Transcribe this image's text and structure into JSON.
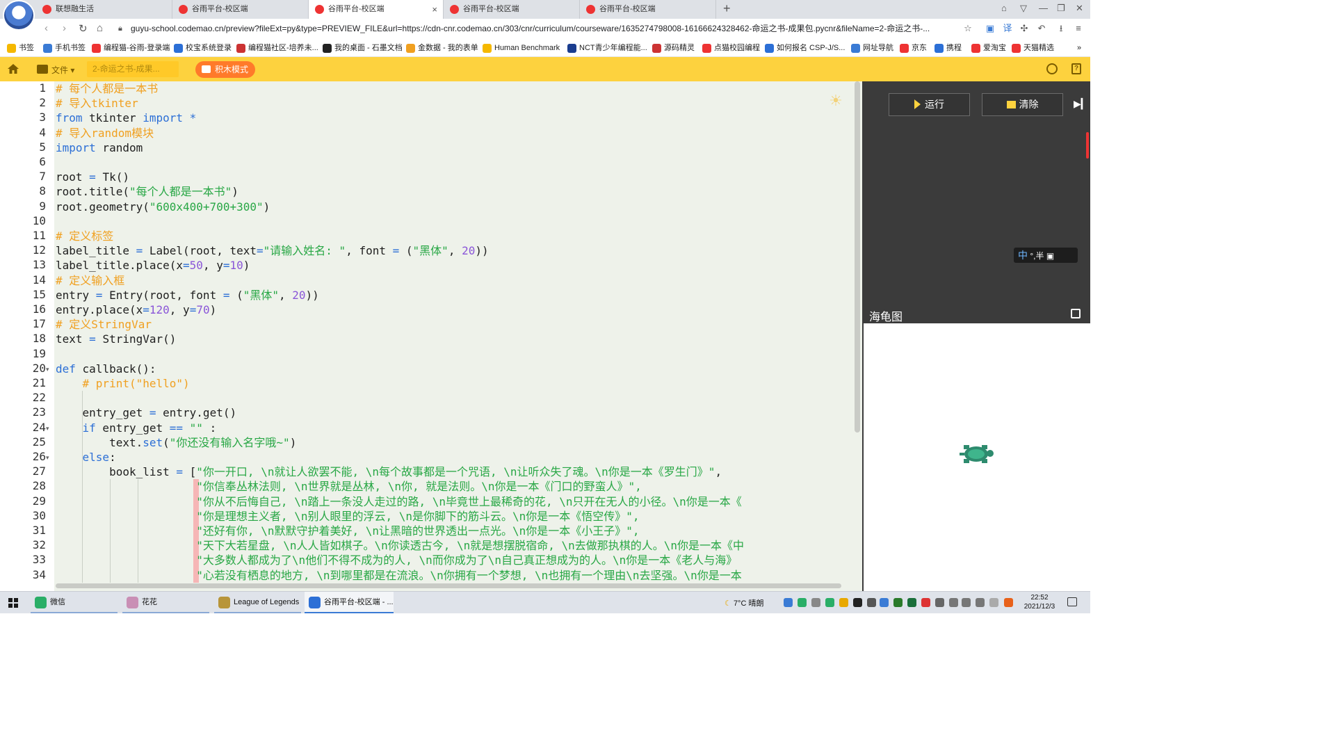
{
  "browser": {
    "tabs": [
      {
        "label": "联想融生活",
        "active": false
      },
      {
        "label": "谷雨平台-校区端",
        "active": false
      },
      {
        "label": "谷雨平台-校区端",
        "active": true
      },
      {
        "label": "谷雨平台-校区端",
        "active": false
      },
      {
        "label": "谷雨平台-校区端",
        "active": false
      }
    ],
    "new_tab": "+",
    "url": "guyu-school.codemao.cn/preview?fileExt=py&type=PREVIEW_FILE&url=https://cdn-cnr.codemao.cn/303/cnr/curriculum/courseware/1635274798008-16166624328462-命运之书-成果包.pycnr&fileName=2-命运之书-...",
    "bookmarks": [
      {
        "label": "书签",
        "color": "#f5b800"
      },
      {
        "label": "手机书签",
        "color": "#3a7bd5"
      },
      {
        "label": "编程猫-谷雨-登录端",
        "color": "#e33"
      },
      {
        "label": "校宝系统登录",
        "color": "#2c6fd6"
      },
      {
        "label": "编程猫社区-培养未...",
        "color": "#c33"
      },
      {
        "label": "我的桌面 - 石墨文档",
        "color": "#222"
      },
      {
        "label": "金数据 - 我的表单",
        "color": "#f0a020"
      },
      {
        "label": "Human Benchmark",
        "color": "#f5b800"
      },
      {
        "label": "NCT青少年编程能...",
        "color": "#1a3d8f"
      },
      {
        "label": "源码精灵",
        "color": "#c33"
      },
      {
        "label": "点猫校园编程",
        "color": "#e33"
      },
      {
        "label": "如何报名 CSP-J/S...",
        "color": "#2c6fd6"
      },
      {
        "label": "网址导航",
        "color": "#3a7bd5"
      },
      {
        "label": "京东",
        "color": "#e33"
      },
      {
        "label": "携程",
        "color": "#2c6fd6"
      },
      {
        "label": "爱淘宝",
        "color": "#e33"
      },
      {
        "label": "天猫精选",
        "color": "#e33"
      }
    ]
  },
  "toolbar": {
    "file_menu": "文件",
    "filename": "2-命运之书-成果...",
    "block_mode": "积木模式"
  },
  "editor": {
    "line_numbers": [
      "1",
      "2",
      "3",
      "4",
      "5",
      "6",
      "7",
      "8",
      "9",
      "10",
      "11",
      "12",
      "13",
      "14",
      "15",
      "16",
      "17",
      "18",
      "19",
      "20",
      "21",
      "22",
      "23",
      "24",
      "25",
      "26",
      "27",
      "28",
      "29",
      "30",
      "31",
      "32",
      "33",
      "34"
    ],
    "folded_lines": [
      20,
      24,
      26
    ],
    "lines": [
      [
        {
          "t": "# 每个人都是一本书",
          "c": "cm"
        }
      ],
      [
        {
          "t": "# 导入tkinter",
          "c": "cm"
        }
      ],
      [
        {
          "t": "from",
          "c": "kw"
        },
        {
          "t": " tkinter ",
          "c": ""
        },
        {
          "t": "import",
          "c": "kw"
        },
        {
          "t": " *",
          "c": "op"
        }
      ],
      [
        {
          "t": "# 导入random模块",
          "c": "cm"
        }
      ],
      [
        {
          "t": "import",
          "c": "kw"
        },
        {
          "t": " random",
          "c": ""
        }
      ],
      [],
      [
        {
          "t": "root ",
          "c": ""
        },
        {
          "t": "=",
          "c": "op"
        },
        {
          "t": " Tk()",
          "c": ""
        }
      ],
      [
        {
          "t": "root.title(",
          "c": ""
        },
        {
          "t": "\"每个人都是一本书\"",
          "c": "st"
        },
        {
          "t": ")",
          "c": ""
        }
      ],
      [
        {
          "t": "root.geometry(",
          "c": ""
        },
        {
          "t": "\"600x400+700+300\"",
          "c": "st"
        },
        {
          "t": ")",
          "c": ""
        }
      ],
      [],
      [
        {
          "t": "# 定义标签",
          "c": "cm"
        }
      ],
      [
        {
          "t": "label_title ",
          "c": ""
        },
        {
          "t": "=",
          "c": "op"
        },
        {
          "t": " Label(root, text",
          "c": ""
        },
        {
          "t": "=",
          "c": "op"
        },
        {
          "t": "\"请输入姓名: \"",
          "c": "st"
        },
        {
          "t": ", font ",
          "c": ""
        },
        {
          "t": "=",
          "c": "op"
        },
        {
          "t": " (",
          "c": ""
        },
        {
          "t": "\"黑体\"",
          "c": "st"
        },
        {
          "t": ", ",
          "c": ""
        },
        {
          "t": "20",
          "c": "nu"
        },
        {
          "t": "))",
          "c": ""
        }
      ],
      [
        {
          "t": "label_title.place(x",
          "c": ""
        },
        {
          "t": "=",
          "c": "op"
        },
        {
          "t": "50",
          "c": "nu"
        },
        {
          "t": ", y",
          "c": ""
        },
        {
          "t": "=",
          "c": "op"
        },
        {
          "t": "10",
          "c": "nu"
        },
        {
          "t": ")",
          "c": ""
        }
      ],
      [
        {
          "t": "# 定义输入框",
          "c": "cm"
        }
      ],
      [
        {
          "t": "entry ",
          "c": ""
        },
        {
          "t": "=",
          "c": "op"
        },
        {
          "t": " Entry(root, font ",
          "c": ""
        },
        {
          "t": "=",
          "c": "op"
        },
        {
          "t": " (",
          "c": ""
        },
        {
          "t": "\"黑体\"",
          "c": "st"
        },
        {
          "t": ", ",
          "c": ""
        },
        {
          "t": "20",
          "c": "nu"
        },
        {
          "t": "))",
          "c": ""
        }
      ],
      [
        {
          "t": "entry.place(x",
          "c": ""
        },
        {
          "t": "=",
          "c": "op"
        },
        {
          "t": "120",
          "c": "nu"
        },
        {
          "t": ", y",
          "c": ""
        },
        {
          "t": "=",
          "c": "op"
        },
        {
          "t": "70",
          "c": "nu"
        },
        {
          "t": ")",
          "c": ""
        }
      ],
      [
        {
          "t": "# 定义StringVar",
          "c": "cm"
        }
      ],
      [
        {
          "t": "text ",
          "c": ""
        },
        {
          "t": "=",
          "c": "op"
        },
        {
          "t": " StringVar()",
          "c": ""
        }
      ],
      [],
      [
        {
          "t": "def",
          "c": "kw"
        },
        {
          "t": " callback():",
          "c": ""
        }
      ],
      [
        {
          "t": "    # print(\"hello\")",
          "c": "cm"
        }
      ],
      [],
      [
        {
          "t": "    entry_get ",
          "c": ""
        },
        {
          "t": "=",
          "c": "op"
        },
        {
          "t": " entry.get()",
          "c": ""
        }
      ],
      [
        {
          "t": "    ",
          "c": ""
        },
        {
          "t": "if",
          "c": "kw"
        },
        {
          "t": " entry_get ",
          "c": ""
        },
        {
          "t": "==",
          "c": "op"
        },
        {
          "t": " ",
          "c": ""
        },
        {
          "t": "\"\"",
          "c": "st"
        },
        {
          "t": " :",
          "c": ""
        }
      ],
      [
        {
          "t": "        text.",
          "c": ""
        },
        {
          "t": "set",
          "c": "kw"
        },
        {
          "t": "(",
          "c": ""
        },
        {
          "t": "\"你还没有输入名字哦~\"",
          "c": "st"
        },
        {
          "t": ")",
          "c": ""
        }
      ],
      [
        {
          "t": "    ",
          "c": ""
        },
        {
          "t": "else",
          "c": "kw"
        },
        {
          "t": ":",
          "c": ""
        }
      ],
      [
        {
          "t": "        book_list ",
          "c": ""
        },
        {
          "t": "=",
          "c": "op"
        },
        {
          "t": " [",
          "c": ""
        },
        {
          "t": "\"你一开口, \\n就让人欲罢不能, \\n每个故事都是一个咒语, \\n让听众失了魂。\\n你是一本《罗生门》\"",
          "c": "st"
        },
        {
          "t": ",",
          "c": ""
        }
      ],
      [
        {
          "t": "                     \"你信奉丛林法则, \\n世界就是丛林, \\n你, 就是法则。\\n你是一本《门口的野蛮人》\",",
          "c": "st"
        }
      ],
      [
        {
          "t": "                     \"你从不后悔自己, \\n踏上一条没人走过的路, \\n毕竟世上最稀奇的花, \\n只开在无人的小径。\\n你是一本《",
          "c": "st"
        }
      ],
      [
        {
          "t": "                     \"你是理想主义者, \\n别人眼里的浮云, \\n是你脚下的筋斗云。\\n你是一本《悟空传》\",",
          "c": "st"
        }
      ],
      [
        {
          "t": "                     \"还好有你, \\n默默守护着美好, \\n让黑暗的世界透出一点光。\\n你是一本《小王子》\",",
          "c": "st"
        }
      ],
      [
        {
          "t": "                     \"天下大若星盘, \\n人人皆如棋子。\\n你读透古今, \\n就是想摆脱宿命, \\n去做那执棋的人。\\n你是一本《中",
          "c": "st"
        }
      ],
      [
        {
          "t": "                     \"大多数人都成为了\\n他们不得不成为的人, \\n而你成为了\\n自己真正想成为的人。\\n你是一本《老人与海》",
          "c": "st"
        }
      ],
      [
        {
          "t": "                     \"心若没有栖息的地方, \\n到哪里都是在流浪。\\n你拥有一个梦想, \\n也拥有一个理由\\n去坚强。\\n你是一本",
          "c": "st"
        }
      ]
    ]
  },
  "right_panel": {
    "run_label": "运行",
    "clear_label": "清除",
    "turtle_title": "海龟图",
    "ime_text": "°,半"
  },
  "taskbar": {
    "tasks": [
      {
        "label": "微信",
        "color": "#2aae67"
      },
      {
        "label": "花花",
        "color": "#c98fb5"
      },
      {
        "label": "League of Legends",
        "color": "#b8953a"
      },
      {
        "label": "谷雨平台-校区端 - ...",
        "color": "#2c6fd6"
      }
    ],
    "weather_temp": "7°C",
    "weather_text": "晴朗",
    "time": "22:52",
    "date": "2021/12/3"
  },
  "colors": {
    "accent": "#fdd23e",
    "block_mode": "#ff7a2a",
    "panel_dark": "#3b3b3b",
    "editor_bg": "#eef2ea"
  }
}
